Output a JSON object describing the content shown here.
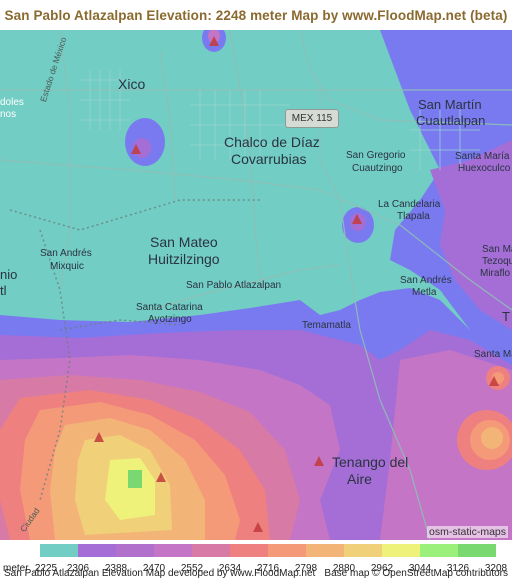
{
  "title": "San Pablo Atlazalpan Elevation: 2248 meter Map by www.FloodMap.net (beta)",
  "road_shield": "MEX 115",
  "places": {
    "xico": "Xico",
    "chalco_1": "Chalco de Díaz",
    "chalco_2": "Covarrubias",
    "san_martin_1": "San Martín",
    "san_martin_2": "Cuautlalpan",
    "san_gregorio_1": "San Gregorio",
    "san_gregorio_2": "Cuautzingo",
    "santa_maria_1": "Santa María",
    "santa_maria_2": "Huexoculco",
    "la_candelaria_1": "La Candelaria",
    "la_candelaria_2": "Tlapala",
    "san_mateo_1": "San Mateo",
    "san_mateo_2": "Huitzilzingo",
    "san_andres_mixquic_1": "San Andrés",
    "san_andres_mixquic_2": "Mixquic",
    "san_pablo": "San Pablo Atlazalpan",
    "san_andres_metla_1": "San Andrés",
    "san_andres_metla_2": "Metla",
    "santa_catarina_1": "Santa Catarina",
    "santa_catarina_2": "Ayotzingo",
    "temamatla": "Temamatla",
    "tenango_1": "Tenango del",
    "tenango_2": "Aire",
    "edge_nio": "nio",
    "edge_tl": "tl",
    "edge_san_ma": "San Ma",
    "edge_tezoqu": "Tezoqu",
    "edge_miraflo": "Miraflo",
    "edge_santa_ma": "Santa Ma",
    "edge_t": "T",
    "edge_doles": "doles",
    "edge_nos": "nos",
    "edge_ciudad": "Ciudad"
  },
  "street_labels": {
    "estado_mexico": "Estado de México"
  },
  "map_attribution": "osm-static-maps",
  "legend": {
    "unit_label": "meter",
    "items": [
      {
        "value": "2225",
        "color": "#72cdc4"
      },
      {
        "value": "2306",
        "color": "#7a7af0"
      },
      {
        "value": "2388",
        "color": "#a46ed6"
      },
      {
        "value": "2470",
        "color": "#b070cc"
      },
      {
        "value": "2552",
        "color": "#c475c6"
      },
      {
        "value": "2634",
        "color": "#d77aa6"
      },
      {
        "value": "2716",
        "color": "#ee8080"
      },
      {
        "value": "2798",
        "color": "#f49a78"
      },
      {
        "value": "2880",
        "color": "#f3b478"
      },
      {
        "value": "2962",
        "color": "#f0d078"
      },
      {
        "value": "3044",
        "color": "#eef27a"
      },
      {
        "value": "3126",
        "color": "#9af07a"
      },
      {
        "value": "3208",
        "color": "#7ad870"
      }
    ]
  },
  "footer": {
    "left": "San Pablo Atlazalpan Elevation Map developed by www.FloodMap.net",
    "right": "Base map © OpenStreetMap contributors"
  }
}
